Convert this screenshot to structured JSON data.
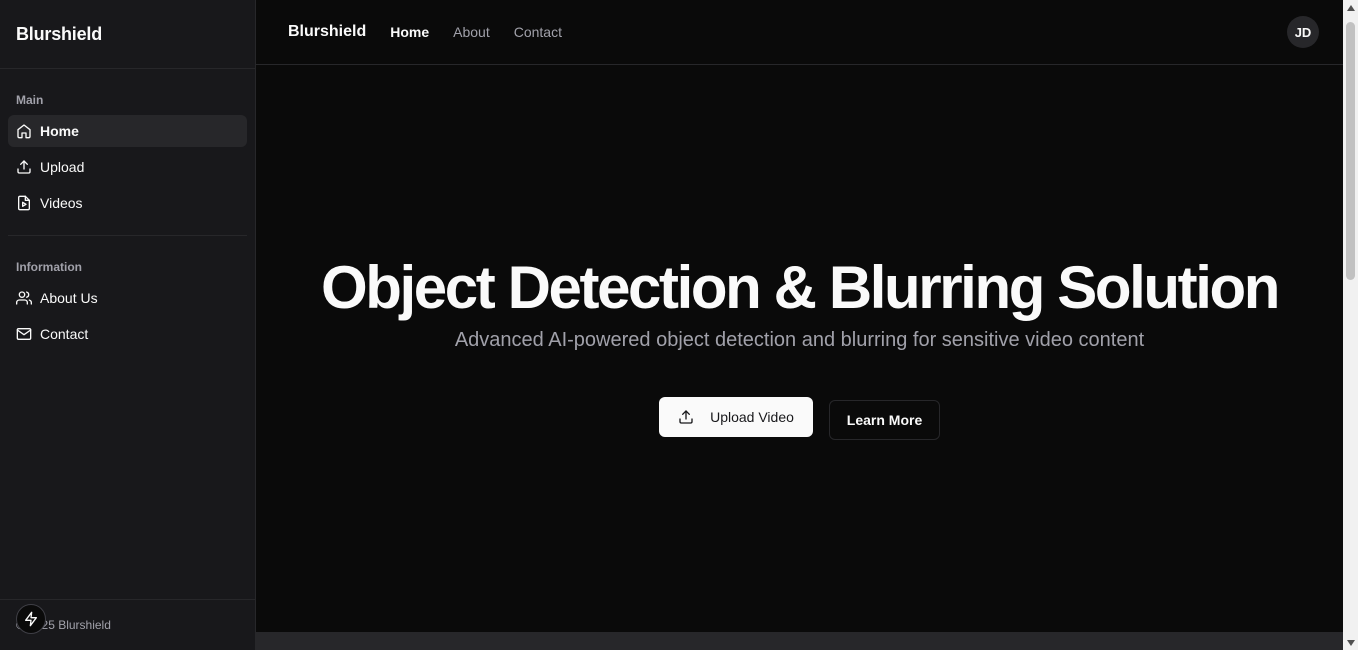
{
  "sidebar": {
    "brand": "Blurshield",
    "groups": [
      {
        "label": "Main",
        "items": [
          {
            "label": "Home",
            "icon": "home-icon",
            "active": true
          },
          {
            "label": "Upload",
            "icon": "upload-icon"
          },
          {
            "label": "Videos",
            "icon": "video-file-icon"
          }
        ]
      },
      {
        "label": "Information",
        "items": [
          {
            "label": "About Us",
            "icon": "users-icon"
          },
          {
            "label": "Contact",
            "icon": "mail-icon"
          }
        ]
      }
    ],
    "footer": "© 2025 Blurshield"
  },
  "topbar": {
    "brand": "Blurshield",
    "links": [
      {
        "label": "Home",
        "active": true
      },
      {
        "label": "About"
      },
      {
        "label": "Contact"
      }
    ],
    "avatar_initials": "JD"
  },
  "hero": {
    "title": "Object Detection & Blurring Solution",
    "subtitle": "Advanced AI-powered object detection and blurring for sensitive video content",
    "primary_button": "Upload Video",
    "secondary_button": "Learn More"
  },
  "colors": {
    "background": "#0a0a0a",
    "sidebar": "#18181b",
    "border": "#27272a",
    "muted_text": "#a1a1aa",
    "primary_button": "#fafafa"
  }
}
